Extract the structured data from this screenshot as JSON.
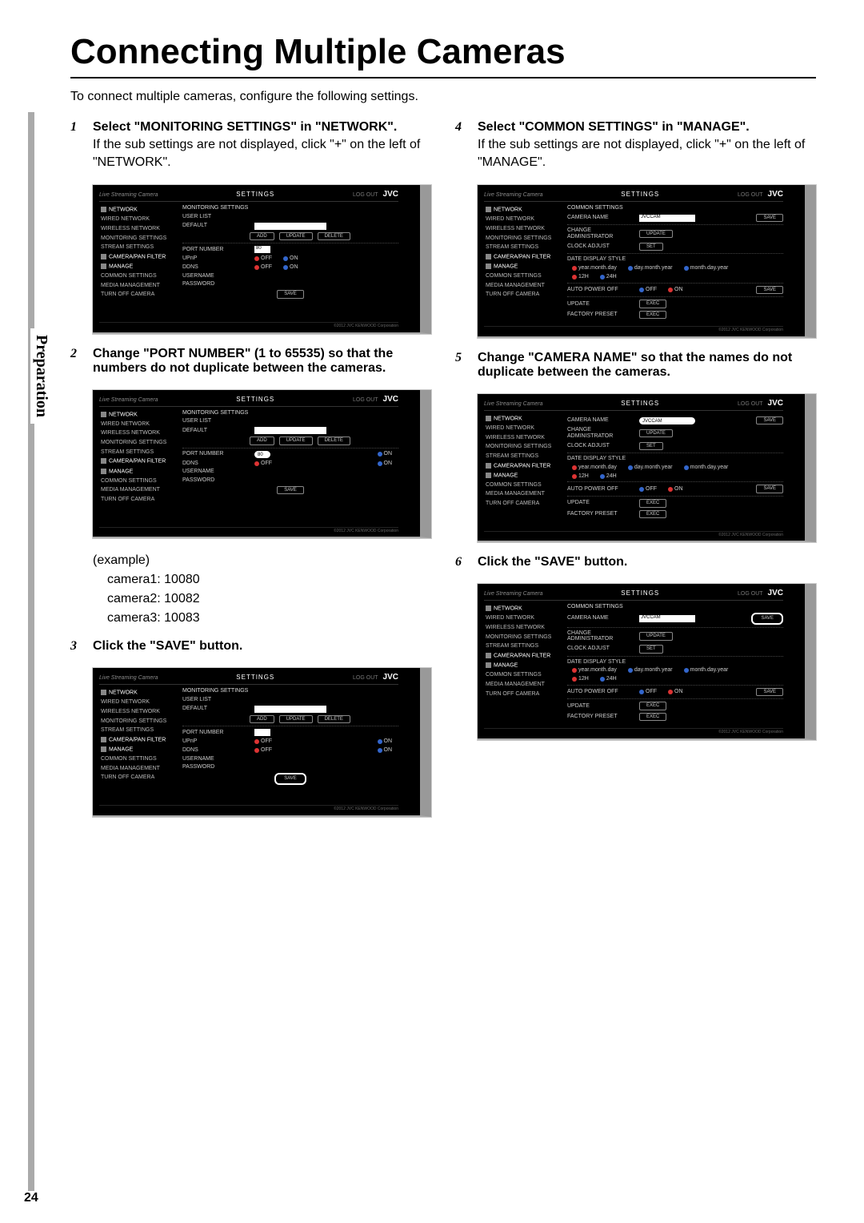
{
  "sidebar_tab": "Preparation",
  "page_number": "24",
  "title": "Connecting Multiple Cameras",
  "intro": "To connect multiple cameras, configure the following settings.",
  "steps": {
    "s1": {
      "num": "1",
      "title": "Select \"MONITORING SETTINGS\" in \"NETWORK\".",
      "body": "If the sub settings are not displayed, click \"+\" on the left of \"NETWORK\"."
    },
    "s2": {
      "num": "2",
      "title": "Change \"PORT NUMBER\" (1 to 65535) so that the numbers do not duplicate between the cameras."
    },
    "s2_example": {
      "label": "(example)",
      "r1": "camera1: 10080",
      "r2": "camera2: 10082",
      "r3": "camera3: 10083"
    },
    "s3": {
      "num": "3",
      "title": "Click the \"SAVE\" button."
    },
    "s4": {
      "num": "4",
      "title": "Select \"COMMON SETTINGS\" in \"MANAGE\".",
      "body": "If the sub settings are not displayed, click \"+\" on the left of \"MANAGE\"."
    },
    "s5": {
      "num": "5",
      "title": "Change \"CAMERA NAME\" so that the names do not duplicate between the cameras."
    },
    "s6": {
      "num": "6",
      "title": "Click the \"SAVE\" button."
    }
  },
  "shot": {
    "brand": "Live Streaming Camera",
    "settings": "SETTINGS",
    "logout": "LOG OUT",
    "jvc": "JVC",
    "footer": "©2012 JVC KENWOOD Corporation",
    "side": {
      "network": "NETWORK",
      "wired": "WIRED NETWORK",
      "wireless": "WIRELESS NETWORK",
      "monitoring": "MONITORING SETTINGS",
      "stream": "STREAM SETTINGS",
      "cam_filter": "CAMERA/PAN FILTER",
      "manage": "MANAGE",
      "common": "COMMON SETTINGS",
      "media": "MEDIA MANAGEMENT",
      "turn_off": "TURN OFF CAMERA"
    },
    "monitoring": {
      "section": "MONITORING SETTINGS",
      "user_list": "USER LIST",
      "default": "DEFAULT",
      "add": "ADD",
      "update": "UPDATE",
      "delete": "DELETE",
      "port": "PORT NUMBER",
      "port_val": "80",
      "upnp": "UPnP",
      "ddns": "DDNS",
      "username": "USERNAME",
      "password": "PASSWORD",
      "save": "SAVE",
      "on": "ON",
      "off": "OFF"
    },
    "common": {
      "section": "COMMON SETTINGS",
      "cam_name": "CAMERA NAME",
      "cam_val": "JVCCAM",
      "change_admin": "CHANGE ADMINISTRATOR",
      "clock": "CLOCK ADJUST",
      "date_style": "DATE DISPLAY STYLE",
      "ymd": "year.month.day",
      "dmy": "day.month.year",
      "mdy": "month.day.year",
      "h12": "12H",
      "h24": "24H",
      "auto_off": "AUTO POWER OFF",
      "update": "UPDATE",
      "factory": "FACTORY PRESET",
      "set": "SET",
      "exec": "EXEC",
      "save": "SAVE",
      "on": "ON",
      "off": "OFF"
    }
  }
}
